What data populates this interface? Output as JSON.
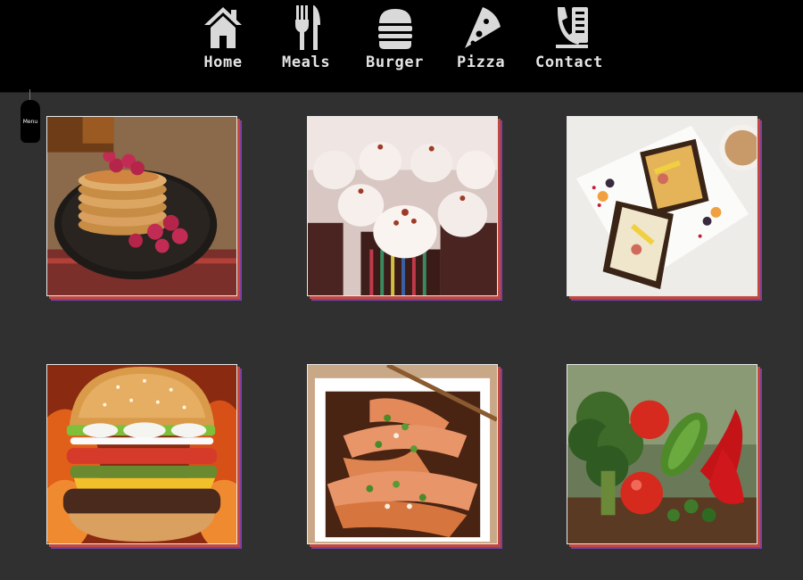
{
  "nav": {
    "items": [
      {
        "label": "Home",
        "icon": "home-icon"
      },
      {
        "label": "Meals",
        "icon": "fork-knife-icon"
      },
      {
        "label": "Burger",
        "icon": "burger-icon"
      },
      {
        "label": "Pizza",
        "icon": "pizza-slice-icon"
      },
      {
        "label": "Contact",
        "icon": "phone-contact-icon"
      }
    ],
    "icon_color": "#d9d9d9",
    "background": "#000000"
  },
  "menu_tab": {
    "label": "Menu"
  },
  "gallery": {
    "tiles": [
      {
        "subject": "pancakes-with-raspberries"
      },
      {
        "subject": "frosted-cupcakes"
      },
      {
        "subject": "open-faced-sandwiches"
      },
      {
        "subject": "hamburger"
      },
      {
        "subject": "grilled-salmon"
      },
      {
        "subject": "fresh-vegetables"
      }
    ]
  },
  "colors": {
    "page_background": "#303030",
    "tile_shadow_red": "#c2473c",
    "tile_shadow_purple": "#7a3fa3"
  }
}
